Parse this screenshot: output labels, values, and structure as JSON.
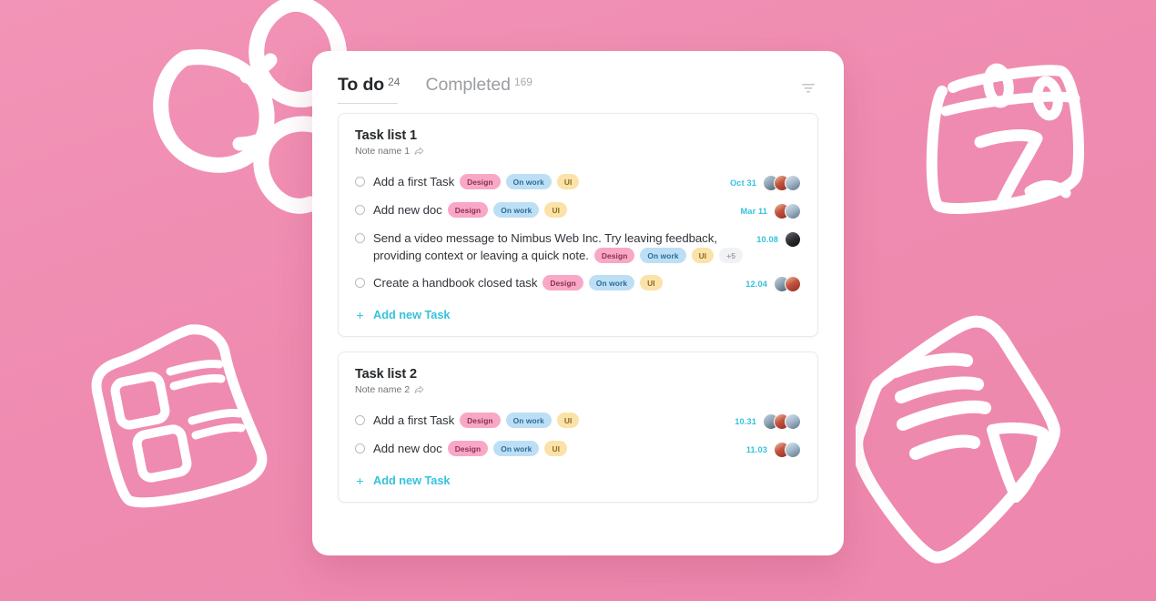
{
  "background": {
    "color": "#ef8bb0",
    "doodles": [
      {
        "name": "network-doodle"
      },
      {
        "name": "calendar-doodle",
        "day": "7"
      },
      {
        "name": "checklist-doodle"
      },
      {
        "name": "note-doodle"
      }
    ]
  },
  "header": {
    "tabs": [
      {
        "label": "To do",
        "count": "24",
        "active": true
      },
      {
        "label": "Completed",
        "count": "169",
        "active": false
      }
    ],
    "filter_icon": "filter-icon"
  },
  "lists": [
    {
      "title": "Task list 1",
      "note": "Note name 1",
      "share_icon": "share-icon",
      "add_task_label": "Add new Task",
      "add_task_plus": "+",
      "tasks": [
        {
          "text": "Add a first Task",
          "text2": "",
          "tags": [
            "Design",
            "On work",
            "UI"
          ],
          "more": "",
          "date": "Oct 31",
          "avatars": [
            "av-a",
            "av-b",
            "av-c"
          ]
        },
        {
          "text": "Add new doc",
          "text2": "",
          "tags": [
            "Design",
            "On work",
            "UI"
          ],
          "more": "",
          "date": "Mar 11",
          "avatars": [
            "av-b",
            "av-c"
          ]
        },
        {
          "text": "Send a video message to Nimbus Web Inc. Try leaving feedback,",
          "text2": "providing context or leaving a quick note.",
          "tags": [
            "Design",
            "On work",
            "UI"
          ],
          "more": "+5",
          "date": "10.08",
          "avatars": [
            "av-d"
          ]
        },
        {
          "text": "Create a handbook closed task",
          "text2": "",
          "tags": [
            "Design",
            "On work",
            "UI"
          ],
          "more": "",
          "date": "12.04",
          "avatars": [
            "av-a",
            "av-b"
          ]
        }
      ]
    },
    {
      "title": "Task list 2",
      "note": "Note name 2",
      "share_icon": "share-icon",
      "add_task_label": "Add new Task",
      "add_task_plus": "+",
      "tasks": [
        {
          "text": "Add a first Task",
          "text2": "",
          "tags": [
            "Design",
            "On work",
            "UI"
          ],
          "more": "",
          "date": "10.31",
          "avatars": [
            "av-a",
            "av-b",
            "av-c"
          ]
        },
        {
          "text": "Add new doc",
          "text2": "",
          "tags": [
            "Design",
            "On work",
            "UI"
          ],
          "more": "",
          "date": "11.03",
          "avatars": [
            "av-b",
            "av-c"
          ]
        }
      ]
    }
  ],
  "colors": {
    "accent": "#35c2de",
    "tag_design_bg": "#f8a8c6",
    "tag_onwork_bg": "#bddff5",
    "tag_ui_bg": "#fbe2a8",
    "background_pink": "#ef8bb0"
  }
}
